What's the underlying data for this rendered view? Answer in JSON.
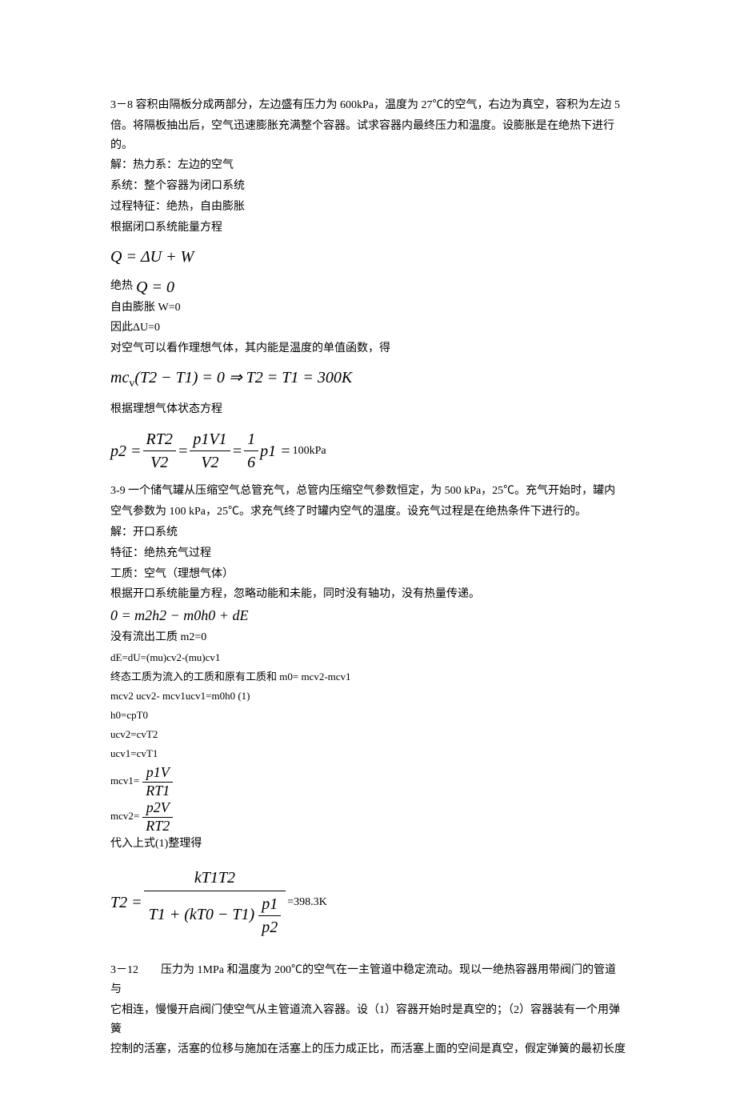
{
  "p38": {
    "line1": "3－8 容积由隔板分成两部分，左边盛有压力为 600kPa，温度为 27℃的空气，右边为真空，容积为左边 5",
    "line2": "倍。将隔板抽出后，空气迅速膨胀充满整个容器。试求容器内最终压力和温度。设膨胀是在绝热下进行的。",
    "line3": "解：热力系：左边的空气",
    "line4": "系统：整个容器为闭口系统",
    "line5": "过程特征：绝热，自由膨胀",
    "line6": "根据闭口系统能量方程",
    "eq1": "Q = ΔU + W",
    "line7a": "绝热",
    "eq2": "Q = 0",
    "line8": "自由膨胀 W=0",
    "line9": "因此ΔU=0",
    "line10": "对空气可以看作理想气体，其内能是温度的单值函数，得",
    "eq3_left": "mc",
    "eq3_sub": "v",
    "eq3_mid": "(T2 − T1) = 0 ⇒ T2 = T1 = 300K",
    "line11": "根据理想气体状态方程",
    "eq4": {
      "p2": "p2 =",
      "f1n": "RT2",
      "f1d": "V2",
      "eq": "=",
      "f2n": "p1V1",
      "f2d": "V2",
      "eq2": "=",
      "f3n": "1",
      "f3d": "6",
      "tail": "p1 =",
      "result": "100kPa"
    }
  },
  "p39": {
    "line1": "3-9 一个储气罐从压缩空气总管充气，总管内压缩空气参数恒定，为 500 kPa，25℃。充气开始时，罐内",
    "line2": "空气参数为 100 kPa，25℃。求充气终了时罐内空气的温度。设充气过程是在绝热条件下进行的。",
    "line3": "解：开口系统",
    "line4": "特征：绝热充气过程",
    "line5": "工质：空气（理想气体）",
    "line6": "根据开口系统能量方程，忽略动能和未能，同时没有轴功，没有热量传递。",
    "eq1": "0 = m2h2 − m0h0 + dE",
    "line7": "没有流出工质 m2=0",
    "line8": "dE=dU=(mu)cv2-(mu)cv1",
    "line9": "终态工质为流入的工质和原有工质和 m0= mcv2-mcv1",
    "line10": "mcv2 ucv2- mcv1ucv1=m0h0                              (1)",
    "line11": "h0=cpT0",
    "line12": "ucv2=cvT2",
    "line13": "ucv1=cvT1",
    "eq_m1": {
      "label": "mcv1=",
      "num": "p1V",
      "den": "RT1"
    },
    "eq_m2": {
      "label": "mcv2=",
      "num": "p2V",
      "den": "RT2"
    },
    "line14": "代入上式(1)整理得",
    "eq_T2": {
      "lhs": "T2 =",
      "num": "kT1T2",
      "den_left": "T1 + (kT0 − T1)",
      "den_fn": "p1",
      "den_fd": "p2",
      "result": "=398.3K"
    }
  },
  "p312": {
    "line1": "3－12　　压力为 1MPa 和温度为 200℃的空气在一主管道中稳定流动。现以一绝热容器用带阀门的管道与",
    "line2": "它相连，慢慢开启阀门使空气从主管道流入容器。设（1）容器开始时是真空的；（2）容器装有一个用弹簧",
    "line3": "控制的活塞，活塞的位移与施加在活塞上的压力成正比，而活塞上面的空间是真空，假定弹簧的最初长度"
  }
}
